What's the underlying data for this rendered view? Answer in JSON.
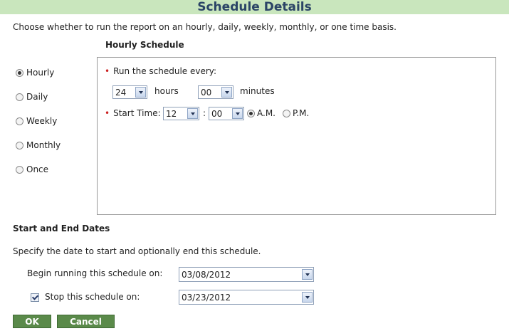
{
  "title": "Schedule Details",
  "description": "Choose whether to run the report on an hourly, daily, weekly, monthly, or one time basis.",
  "schedule_heading": "Hourly Schedule",
  "frequency_options": [
    {
      "label": "Hourly",
      "selected": true
    },
    {
      "label": "Daily",
      "selected": false
    },
    {
      "label": "Weekly",
      "selected": false
    },
    {
      "label": "Monthly",
      "selected": false
    },
    {
      "label": "Once",
      "selected": false
    }
  ],
  "hourly": {
    "run_every_label": "Run the schedule every:",
    "hours_value": "24",
    "hours_label": "hours",
    "minutes_value": "00",
    "minutes_label": "minutes",
    "start_time_label": "Start Time:",
    "start_hour": "12",
    "colon": ":",
    "start_minute": "00",
    "am_label": "A.M.",
    "pm_label": "P.M.",
    "meridiem": "A.M."
  },
  "dates": {
    "heading": "Start and End Dates",
    "description": "Specify the date to start and optionally end this schedule.",
    "begin_label": "Begin running this schedule on:",
    "begin_value": "03/08/2012",
    "stop_label": "Stop this schedule on:",
    "stop_checked": true,
    "stop_value": "03/23/2012"
  },
  "buttons": {
    "ok": "OK",
    "cancel": "Cancel"
  },
  "colors": {
    "title_bg": "#c9e6bd",
    "title_text": "#2b4466",
    "button_bg": "#5a8a4a",
    "required_bullet": "#cc2222"
  }
}
